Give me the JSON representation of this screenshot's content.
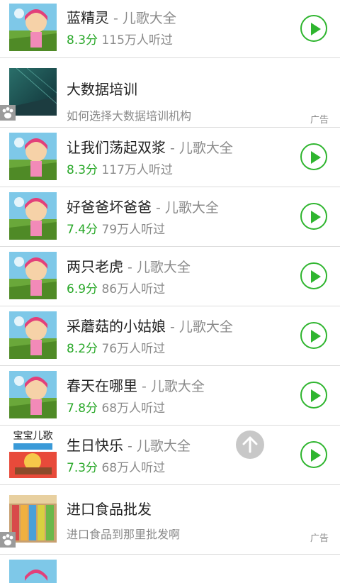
{
  "songs": [
    {
      "title": "蓝精灵",
      "album": " - 儿歌大全",
      "score": "8.3分",
      "plays": "115万人听过"
    },
    {
      "title": "让我们荡起双浆",
      "album": " - 儿歌大全",
      "score": "8.3分",
      "plays": "117万人听过"
    },
    {
      "title": "好爸爸坏爸爸",
      "album": " - 儿歌大全",
      "score": "7.4分",
      "plays": "79万人听过"
    },
    {
      "title": "两只老虎",
      "album": " - 儿歌大全",
      "score": "6.9分",
      "plays": "86万人听过"
    },
    {
      "title": "采蘑菇的小姑娘",
      "album": " - 儿歌大全",
      "score": "8.2分",
      "plays": "76万人听过"
    },
    {
      "title": "春天在哪里",
      "album": " - 儿歌大全",
      "score": "7.8分",
      "plays": "68万人听过"
    },
    {
      "title": "生日快乐",
      "album": " - 儿歌大全",
      "score": "7.3分",
      "plays": "68万人听过"
    }
  ],
  "ads": [
    {
      "title": "大数据培训",
      "desc": "如何选择大数据培训机构",
      "tag": "广告"
    },
    {
      "title": "进口食品批发",
      "desc": "进口食品到那里批发啊",
      "tag": "广告"
    }
  ],
  "thumb_logo_text": "宝宝儿歌",
  "colors": {
    "accent": "#2fb52f",
    "score": "#29a829",
    "muted": "#8a8a8a"
  }
}
